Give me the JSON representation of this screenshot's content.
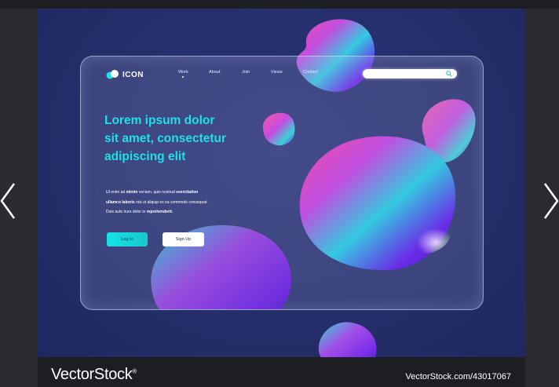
{
  "brand": {
    "logo_text": "ICON"
  },
  "nav": {
    "items": [
      {
        "label": "Work",
        "active": true
      },
      {
        "label": "About",
        "active": false
      },
      {
        "label": "Join",
        "active": false
      },
      {
        "label": "Views",
        "active": false
      },
      {
        "label": "Contact",
        "active": false
      }
    ]
  },
  "search": {
    "placeholder": ""
  },
  "hero": {
    "headline_lines": [
      "Lorem ipsum dolor",
      "sit amet, consectetur",
      "adipiscing elit"
    ],
    "body": {
      "l1_a": "Ut enim ad ",
      "l1_b": "minim",
      "l1_c": " veniam, quis nostrud ",
      "l1_d": "exercitation",
      "l2_a": "ullamco laboris",
      "l2_b": " nisi ut aliquip ex ea commodo consequat.",
      "l3_a": "Duis aute irure dolor in ",
      "l3_b": "reprehenderit."
    },
    "buttons": {
      "login": "Log In",
      "signup": "Sign Up"
    }
  },
  "footer": {
    "brand": "VectorStock",
    "brand_mark": "®",
    "url": "VectorStock.com/43017067"
  },
  "colors": {
    "stage_bg": "#252e6a",
    "accent_cyan": "#1fe0e8",
    "blob_purple": "#6a1fe0",
    "blob_magenta": "#d23cd6",
    "blob_teal": "#27c6d8"
  },
  "icons": {
    "logo": "logo-mark-icon",
    "search": "search-icon",
    "prev": "chevron-left-icon",
    "next": "chevron-right-icon"
  }
}
